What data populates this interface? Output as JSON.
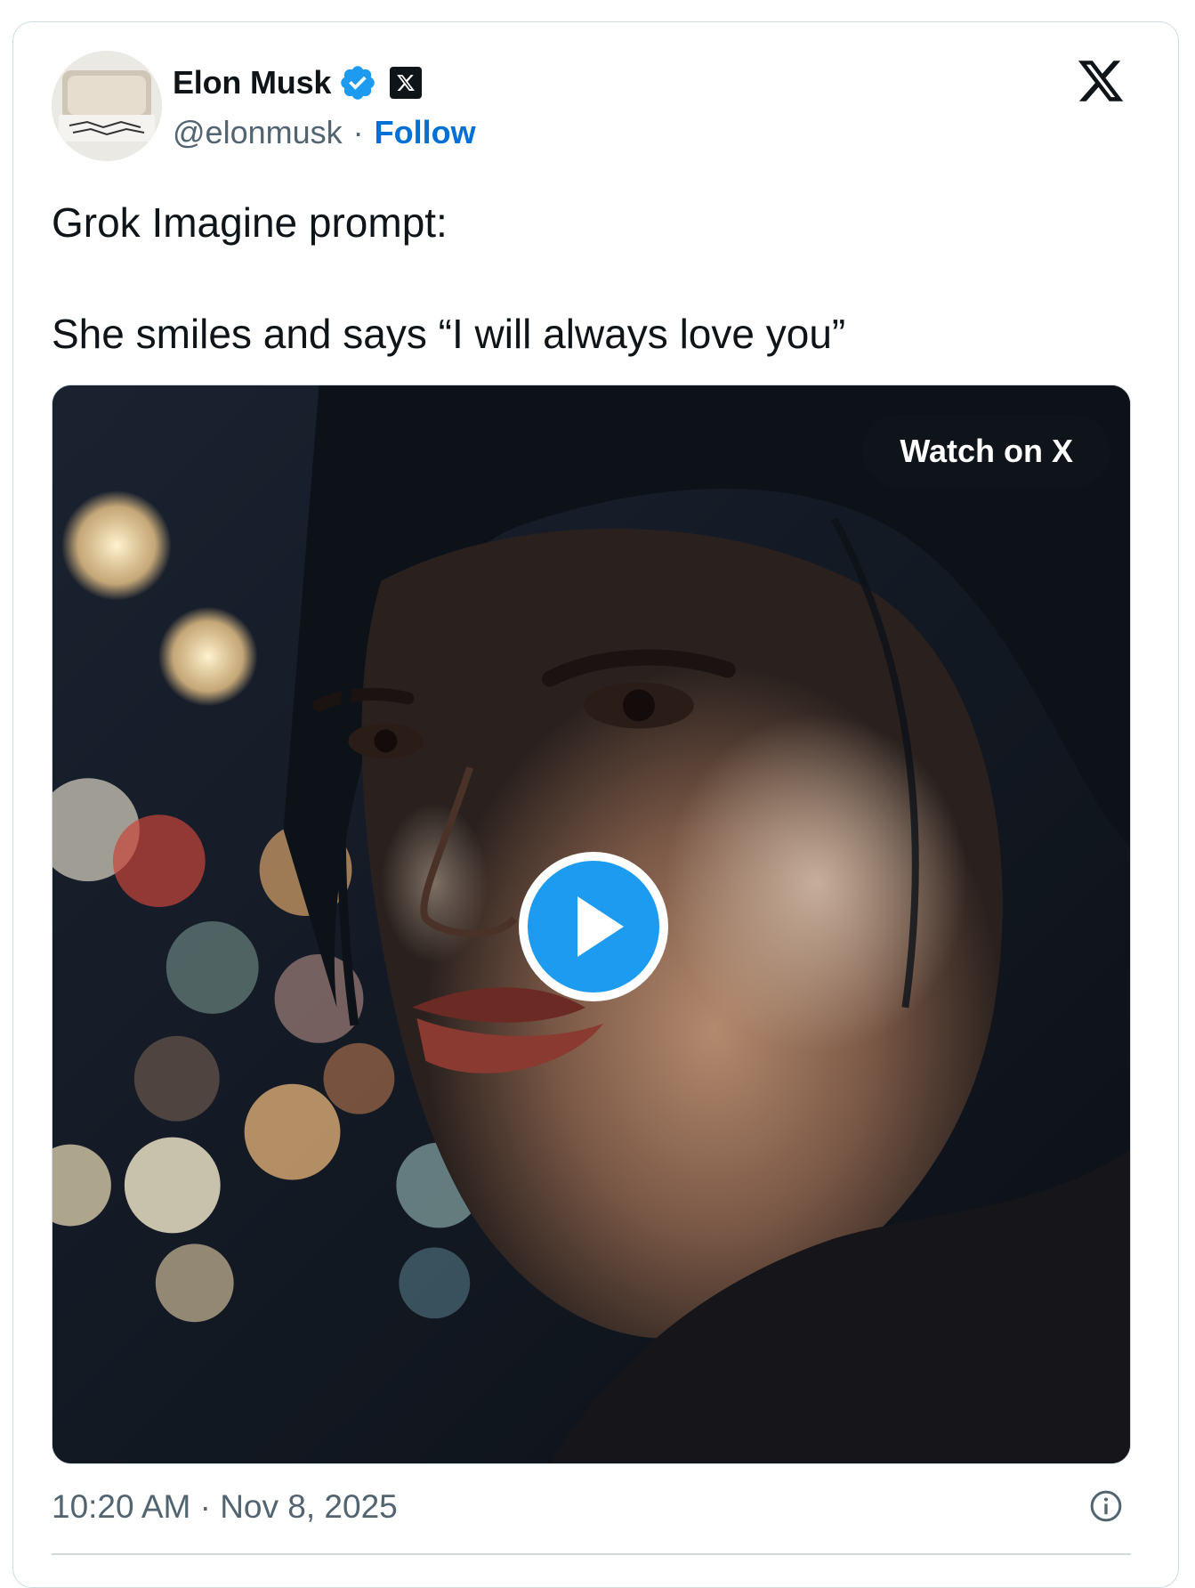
{
  "author": {
    "name": "Elon Musk",
    "handle": "@elonmusk",
    "separator": "·",
    "follow_label": "Follow",
    "verified_icon": "verified-badge-icon",
    "affiliation_icon": "x-affiliate-badge-icon"
  },
  "tweet": {
    "line1": "Grok Imagine prompt:",
    "line2": "She smiles and says “I will always love you”"
  },
  "media": {
    "type": "video",
    "watch_label": "Watch on X",
    "play_icon": "play-icon"
  },
  "footer": {
    "timestamp": "10:20 AM · Nov 8, 2025",
    "info_icon": "info-icon"
  },
  "colors": {
    "follow": "#006fd6",
    "verified": "#1d9bf0",
    "play": "#1d9bf0",
    "border": "#cfd9de",
    "secondary_text": "#536471"
  }
}
